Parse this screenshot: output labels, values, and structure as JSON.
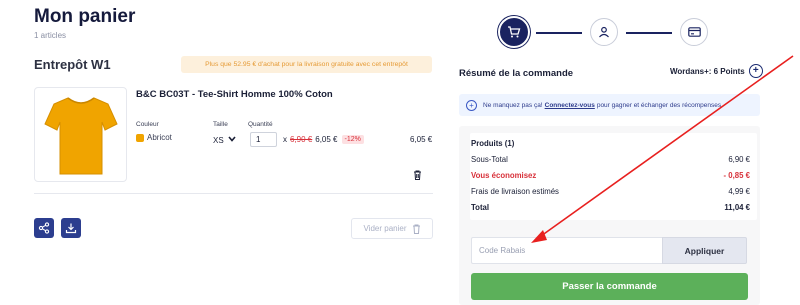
{
  "cart": {
    "title": "Mon panier",
    "subtitle": "1 articles",
    "warehouse": "Entrepôt W1",
    "shipping_banner": "Plus que 52.95 € d'achat pour la livraison gratuite avec cet entrepôt",
    "item": {
      "name": "B&C BC03T - Tee-Shirt Homme 100% Coton",
      "color_label": "Couleur",
      "color_value": "Abricot",
      "color_hex": "#f0a400",
      "size_label": "Taille",
      "size_value": "XS",
      "qty_label": "Quantité",
      "qty_value": "1",
      "times": "x",
      "old_price": "6,90 €",
      "price": "6,05 €",
      "discount": "-12%",
      "line_total": "6,05 €"
    },
    "share_icon": "share-icon",
    "download_icon": "download-icon",
    "clear_label": "Vider panier"
  },
  "steps": [
    {
      "icon": "cart-icon",
      "state": "active"
    },
    {
      "icon": "user-icon",
      "state": "pending"
    },
    {
      "icon": "card-icon",
      "state": "pending"
    }
  ],
  "summary": {
    "title": "Résumé de la commande",
    "points": "Wordans+: 6 Points",
    "info_pre": "Ne manquez pas ça!",
    "info_link": "Connectez-vous",
    "info_post": "pour gagner et échanger des récompenses",
    "rows": [
      {
        "label": "Produits (1)",
        "value": ""
      },
      {
        "label": "Sous-Total",
        "value": "6,90 €"
      },
      {
        "label": "Vous économisez",
        "value": "- 0,85 €"
      },
      {
        "label": "Frais de livraison estimés",
        "value": "4,99 €"
      },
      {
        "label": "Total",
        "value": "11,04 €"
      }
    ],
    "coupon_placeholder": "Code Rabais",
    "apply_label": "Appliquer",
    "checkout_label": "Passer la commande"
  },
  "colors": {
    "brand_navy": "#1a2360",
    "accent_green": "#5cb05a",
    "discount_red": "#d8313a",
    "banner_orange": "#e59a35"
  }
}
